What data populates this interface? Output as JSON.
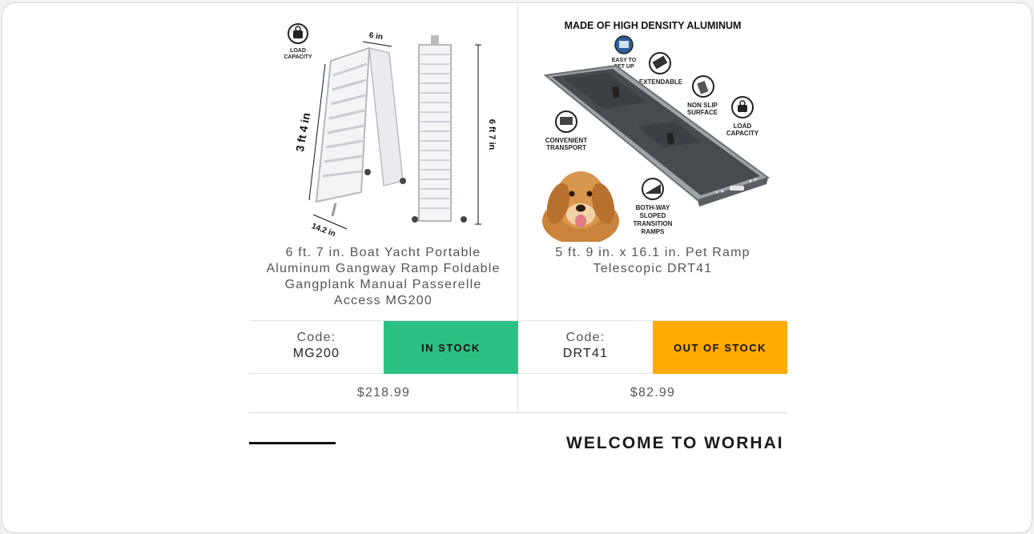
{
  "products": [
    {
      "title": "6 ft. 7 in. Boat Yacht Portable Aluminum Gangway Ramp Foldable Gangplank Manual Passerelle Access MG200",
      "code_label": "Code:",
      "code": "MG200",
      "stock_status": "IN STOCK",
      "stock_color": "#2cc184",
      "price": "$218.99",
      "image_labels": {
        "load_capacity_line1": "LOAD",
        "load_capacity_line2": "CAPACITY",
        "width_top": "6 in",
        "height_folded": "3 ft 4 in",
        "width_bottom": "14.2 in",
        "length_full": "6 ft 7 in"
      }
    },
    {
      "title": "5 ft. 9 in. x 16.1 in. Pet Ramp Telescopic DRT41",
      "code_label": "Code:",
      "code": "DRT41",
      "stock_status": "OUT OF STOCK",
      "stock_color": "#ffaa00",
      "price": "$82.99",
      "image_labels": {
        "headline": "MADE OF HIGH DENSITY ALUMINUM",
        "easy_setup_1": "EASY TO",
        "easy_setup_2": "SET UP",
        "extendable": "EXTENDABLE",
        "non_slip_1": "NON SLIP",
        "non_slip_2": "SURFACE",
        "load_1": "LOAD",
        "load_2": "CAPACITY",
        "convenient_1": "CONVENIENT",
        "convenient_2": "TRANSPORT",
        "both_way_1": "BOTH-WAY",
        "both_way_2": "SLOPED",
        "both_way_3": "TRANSITION",
        "both_way_4": "RAMPS"
      }
    }
  ],
  "welcome": {
    "title": "WELCOME TO WORHAI"
  }
}
